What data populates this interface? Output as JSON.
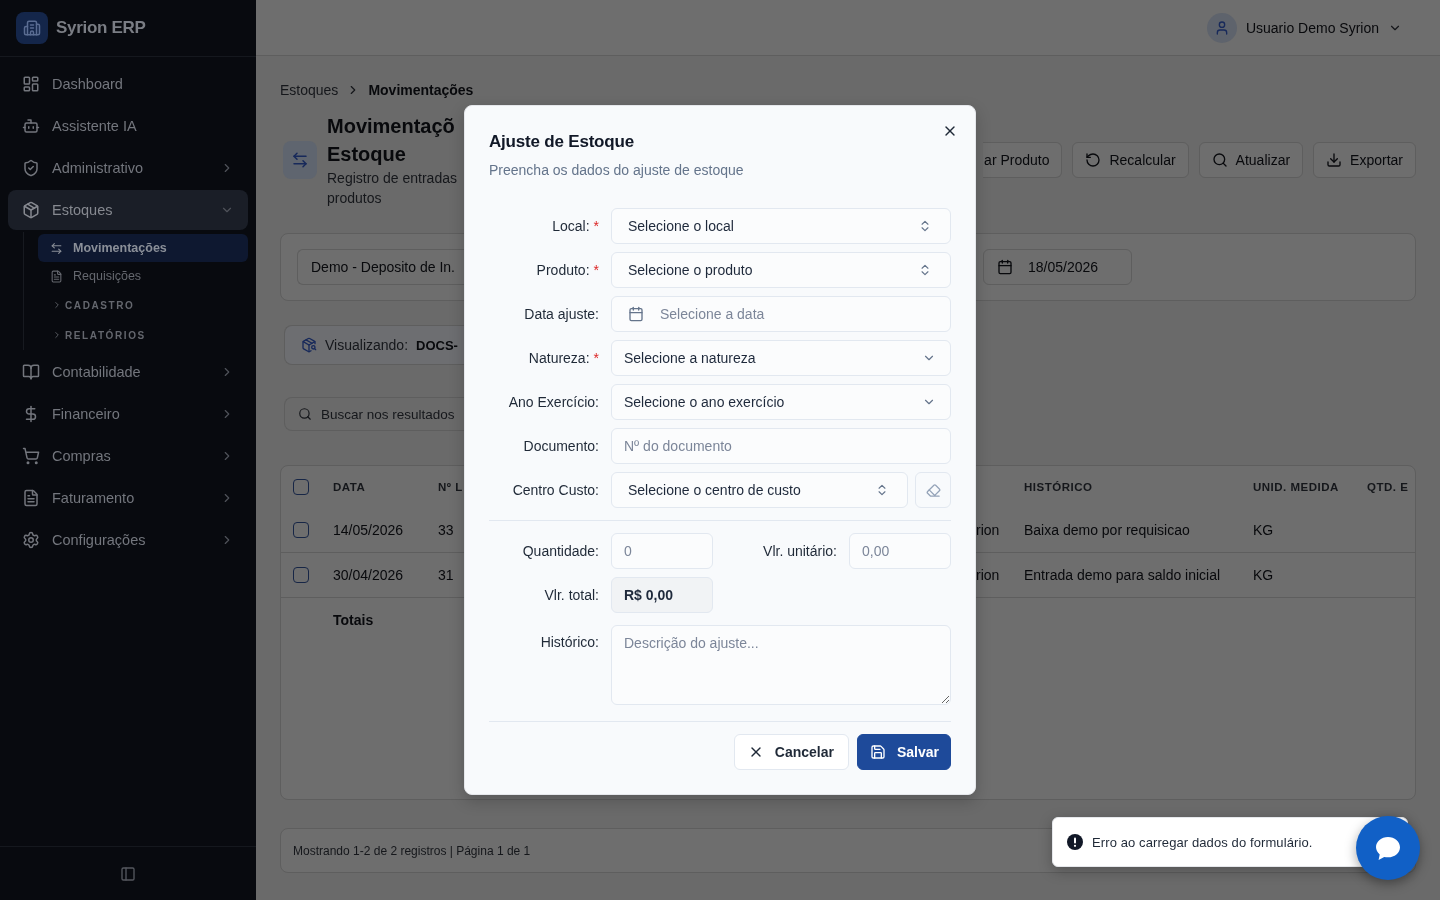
{
  "sidebar": {
    "brand": "Syrion ERP",
    "items": [
      {
        "label": "Dashboard",
        "kind": "link",
        "selected": false
      },
      {
        "label": "Assistente IA",
        "kind": "link",
        "selected": false
      },
      {
        "label": "Administrativo",
        "kind": "group",
        "selected": false,
        "expanded": false
      },
      {
        "label": "Estoques",
        "kind": "group",
        "selected": true,
        "expanded": true,
        "children": [
          {
            "label": "Movimentações",
            "kind": "link",
            "selected": true
          },
          {
            "label": "Requisições",
            "kind": "link",
            "selected": false
          },
          {
            "label": "CADASTRO",
            "kind": "section",
            "expanded": false
          },
          {
            "label": "RELATÓRIOS",
            "kind": "section",
            "expanded": false
          }
        ]
      },
      {
        "label": "Contabilidade",
        "kind": "group",
        "selected": false,
        "expanded": false
      },
      {
        "label": "Financeiro",
        "kind": "group",
        "selected": false,
        "expanded": false
      },
      {
        "label": "Compras",
        "kind": "group",
        "selected": false,
        "expanded": false
      },
      {
        "label": "Faturamento",
        "kind": "group",
        "selected": false,
        "expanded": false
      },
      {
        "label": "Configurações",
        "kind": "group",
        "selected": false,
        "expanded": false
      }
    ]
  },
  "header": {
    "user": "Usuario Demo Syrion"
  },
  "breadcrumb": [
    {
      "label": "Estoques",
      "current": false
    },
    {
      "label": "Movimentações",
      "current": true
    }
  ],
  "page": {
    "title_lines": [
      "Movimentaçõ",
      "Estoque"
    ],
    "subtitle_lines": [
      "Registro de entradas",
      "produtos"
    ],
    "actions": [
      "ar Produto",
      "Recalcular",
      "Atualizar",
      "Exportar"
    ]
  },
  "filters": {
    "location": "Demo - Deposito de In.",
    "date": "18/05/2026"
  },
  "viewing": {
    "label": "Visualizando:",
    "value": "DOCS-"
  },
  "search": {
    "placeholder": "Buscar nos resultados"
  },
  "table": {
    "select_all_checked": false,
    "columns": [
      "DATA",
      "Nº L",
      "",
      "HISTÓRICO",
      "UNID. MEDIDA",
      "QTD. E"
    ],
    "rows": [
      {
        "checked": false,
        "cells": [
          "14/05/2026",
          "33",
          "rion",
          "Baixa demo por requisicao",
          "KG"
        ]
      },
      {
        "checked": false,
        "cells": [
          "30/04/2026",
          "31",
          "rion",
          "Entrada demo para saldo inicial",
          "KG"
        ]
      }
    ],
    "totals_label": "Totais"
  },
  "footer": {
    "text": "Mostrando 1-2 de 2 registros | Página 1 de 1"
  },
  "dialog": {
    "title": "Ajuste de Estoque",
    "description": "Preencha os dados do ajuste de estoque",
    "fields": [
      {
        "label": "Local:",
        "required_mark": "*",
        "kind": "combobox",
        "placeholder": "Selecione o local"
      },
      {
        "label": "Produto:",
        "required_mark": "*",
        "kind": "combobox",
        "placeholder": "Selecione o produto"
      },
      {
        "label": "Data ajuste:",
        "kind": "date",
        "placeholder": "Selecione a data"
      },
      {
        "label": "Natureza:",
        "required_mark": "*",
        "kind": "select",
        "placeholder": "Selecione a natureza"
      },
      {
        "label": "Ano Exercício:",
        "kind": "select",
        "placeholder": "Selecione o ano exercício"
      },
      {
        "label": "Documento:",
        "kind": "text",
        "placeholder": "Nº do documento"
      },
      {
        "label": "Centro Custo:",
        "kind": "combobox",
        "placeholder": "Selecione o centro de custo",
        "clear_button": true
      }
    ],
    "quantity": {
      "label": "Quantidade:",
      "placeholder": "0"
    },
    "unit_value": {
      "label": "Vlr. unitário:",
      "placeholder": "0,00"
    },
    "total": {
      "label": "Vlr. total:",
      "value": "R$ 0,00"
    },
    "history": {
      "label": "Histórico:",
      "placeholder": "Descrição do ajuste..."
    },
    "buttons": [
      {
        "label": "Cancelar",
        "kind": "cancel"
      },
      {
        "label": "Salvar",
        "kind": "save"
      }
    ]
  },
  "toast": {
    "kind": "error",
    "message": "Erro ao carregar dados do formulário."
  }
}
